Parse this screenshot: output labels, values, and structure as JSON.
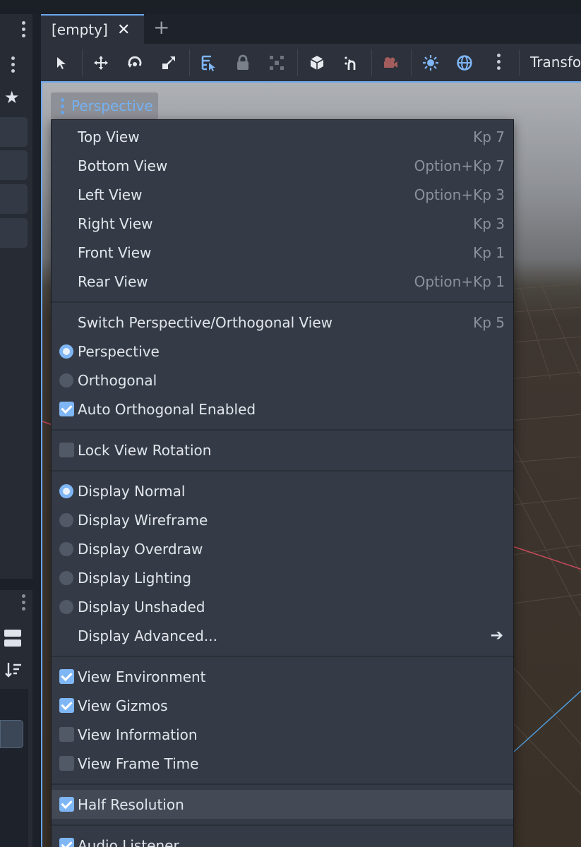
{
  "tabs": [
    {
      "title": "[empty]",
      "close_icon": "close-icon",
      "active": true
    }
  ],
  "tab_add_icon": "plus-icon",
  "toolbar": {
    "icons": [
      "select-arrow-icon",
      "move-icon",
      "rotate-icon",
      "scale-icon",
      "list-select-icon",
      "lock-icon",
      "group-icon",
      "local-space-cube-icon",
      "snap-magnet-icon",
      "camera-icon",
      "sun-icon",
      "globe-icon",
      "more-vertical-icon"
    ],
    "transform_label": "Transfo"
  },
  "viewport": {
    "menu_button_label": "Perspective"
  },
  "menu": {
    "items": [
      {
        "type": "item",
        "label": "Top View",
        "shortcut": "Kp 7"
      },
      {
        "type": "item",
        "label": "Bottom View",
        "shortcut": "Option+Kp 7"
      },
      {
        "type": "item",
        "label": "Left View",
        "shortcut": "Option+Kp 3"
      },
      {
        "type": "item",
        "label": "Right View",
        "shortcut": "Kp 3"
      },
      {
        "type": "item",
        "label": "Front View",
        "shortcut": "Kp 1"
      },
      {
        "type": "item",
        "label": "Rear View",
        "shortcut": "Option+Kp 1"
      },
      {
        "type": "separator"
      },
      {
        "type": "item",
        "label": "Switch Perspective/Orthogonal View",
        "shortcut": "Kp 5"
      },
      {
        "type": "radio",
        "label": "Perspective",
        "checked": true
      },
      {
        "type": "radio",
        "label": "Orthogonal",
        "checked": false
      },
      {
        "type": "check",
        "label": "Auto Orthogonal Enabled",
        "checked": true
      },
      {
        "type": "separator"
      },
      {
        "type": "check",
        "label": "Lock View Rotation",
        "checked": false
      },
      {
        "type": "separator"
      },
      {
        "type": "radio",
        "label": "Display Normal",
        "checked": true
      },
      {
        "type": "radio",
        "label": "Display Wireframe",
        "checked": false
      },
      {
        "type": "radio",
        "label": "Display Overdraw",
        "checked": false
      },
      {
        "type": "radio",
        "label": "Display Lighting",
        "checked": false
      },
      {
        "type": "radio",
        "label": "Display Unshaded",
        "checked": false
      },
      {
        "type": "submenu",
        "label": "Display Advanced...",
        "icon": "arrow-right-icon"
      },
      {
        "type": "separator"
      },
      {
        "type": "check",
        "label": "View Environment",
        "checked": true
      },
      {
        "type": "check",
        "label": "View Gizmos",
        "checked": true
      },
      {
        "type": "check",
        "label": "View Information",
        "checked": false
      },
      {
        "type": "check",
        "label": "View Frame Time",
        "checked": false
      },
      {
        "type": "separator"
      },
      {
        "type": "check",
        "label": "Half Resolution",
        "checked": true,
        "hover": true
      },
      {
        "type": "separator"
      },
      {
        "type": "check",
        "label": "Audio Listener",
        "checked": true
      }
    ]
  },
  "colors": {
    "accent": "#6aa8ef",
    "menu_bg": "#353b46",
    "toolbar_bg": "#2c313b",
    "camera_icon": "#a25c5c"
  }
}
